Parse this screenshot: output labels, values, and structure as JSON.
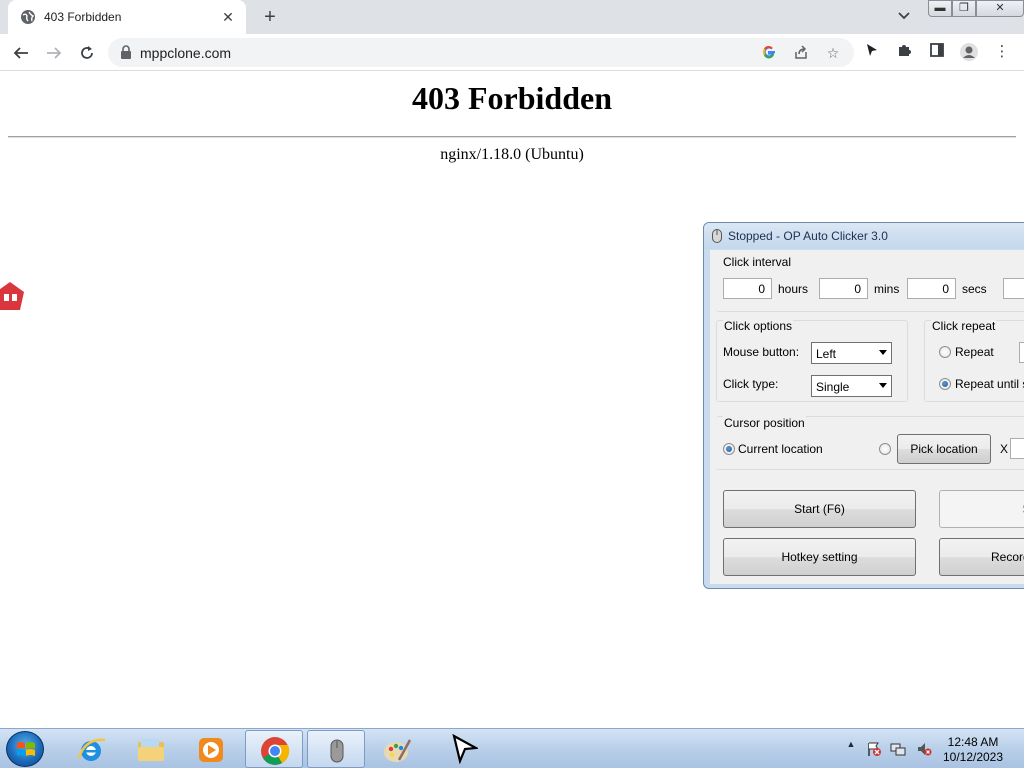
{
  "browser": {
    "tab_title": "403 Forbidden",
    "url": "mppclone.com"
  },
  "page": {
    "heading": "403 Forbidden",
    "server": "nginx/1.18.0 (Ubuntu)"
  },
  "autoclicker": {
    "title": "Stopped - OP Auto Clicker 3.0",
    "click_interval_label": "Click interval",
    "hours_value": "0",
    "hours_label": "hours",
    "mins_value": "0",
    "mins_label": "mins",
    "secs_value": "0",
    "secs_label": "secs",
    "click_options_label": "Click options",
    "mouse_button_label": "Mouse button:",
    "mouse_button_value": "Left",
    "click_type_label": "Click type:",
    "click_type_value": "Single",
    "click_repeat_label": "Click repeat",
    "repeat_label": "Repeat",
    "repeat_until_stopped_label": "Repeat until sto",
    "cursor_position_label": "Cursor position",
    "current_location_label": "Current location",
    "pick_location_label": "Pick location",
    "x_label": "X",
    "start_label": "Start (F6)",
    "stop_label": "Sto",
    "hotkey_label": "Hotkey setting",
    "record_label": "Record"
  },
  "taskbar": {
    "time": "12:48 AM",
    "date": "10/12/2023"
  },
  "icons": {
    "tab_favicon": "globe-icon",
    "tab_close": "close-icon",
    "new_tab": "plus-icon",
    "tab_search": "chevron-down-icon",
    "back": "arrow-left-icon",
    "forward": "arrow-right-icon",
    "reload": "reload-icon",
    "lock": "lock-icon",
    "google": "google-icon",
    "share": "share-icon",
    "bookmark": "star-icon",
    "cursor_ext": "cursor-icon",
    "extensions": "puzzle-icon",
    "side_panel": "side-panel-icon",
    "profile": "profile-icon",
    "menu": "kebab-menu-icon"
  }
}
